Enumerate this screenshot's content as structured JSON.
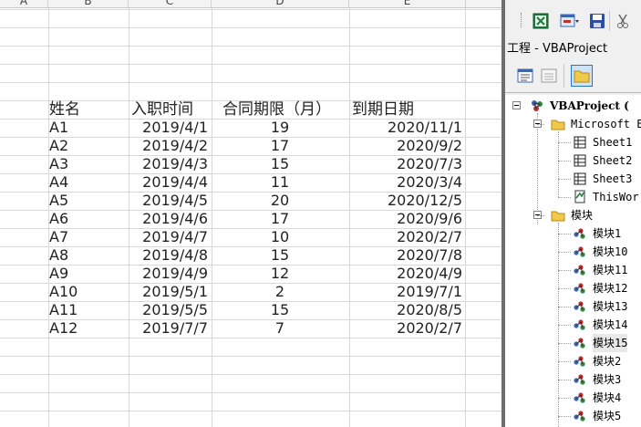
{
  "sheet": {
    "columns": [
      "A",
      "B",
      "C",
      "D",
      "E"
    ],
    "header": {
      "name": "姓名",
      "hire_date": "入职时间",
      "term": "合同期限（月）",
      "expire": "到期日期"
    },
    "rows": [
      {
        "name": "A1",
        "hire_date": "2019/4/1",
        "term": "19",
        "expire": "2020/11/1"
      },
      {
        "name": "A2",
        "hire_date": "2019/4/2",
        "term": "17",
        "expire": "2020/9/2"
      },
      {
        "name": "A3",
        "hire_date": "2019/4/3",
        "term": "15",
        "expire": "2020/7/3"
      },
      {
        "name": "A4",
        "hire_date": "2019/4/4",
        "term": "11",
        "expire": "2020/3/4"
      },
      {
        "name": "A5",
        "hire_date": "2019/4/5",
        "term": "20",
        "expire": "2020/12/5"
      },
      {
        "name": "A6",
        "hire_date": "2019/4/6",
        "term": "17",
        "expire": "2020/9/6"
      },
      {
        "name": "A7",
        "hire_date": "2019/4/7",
        "term": "10",
        "expire": "2020/2/7"
      },
      {
        "name": "A8",
        "hire_date": "2019/4/8",
        "term": "15",
        "expire": "2020/7/8"
      },
      {
        "name": "A9",
        "hire_date": "2019/4/9",
        "term": "12",
        "expire": "2020/4/9"
      },
      {
        "name": "A10",
        "hire_date": "2019/5/1",
        "term": "2",
        "expire": "2019/7/1"
      },
      {
        "name": "A11",
        "hire_date": "2019/5/5",
        "term": "15",
        "expire": "2020/8/5"
      },
      {
        "name": "A12",
        "hire_date": "2019/7/7",
        "term": "7",
        "expire": "2020/2/7"
      }
    ]
  },
  "vbe": {
    "project_title": "工程 - VBAProject",
    "tree": {
      "root": "VBAProject (",
      "objects_folder": "Microsoft E",
      "sheets": [
        "Sheet1",
        "Sheet2",
        "Sheet3",
        "ThisWor"
      ],
      "modules_folder": "模块",
      "modules": [
        "模块1",
        "模块10",
        "模块11",
        "模块12",
        "模块13",
        "模块14",
        "模块15",
        "模块2",
        "模块3",
        "模块4",
        "模块5"
      ],
      "selected_module": "模块15"
    },
    "colors": {
      "border": "#6e6e6e",
      "selection": "#2a74c8",
      "excel_green": "#1f7a3d"
    }
  }
}
